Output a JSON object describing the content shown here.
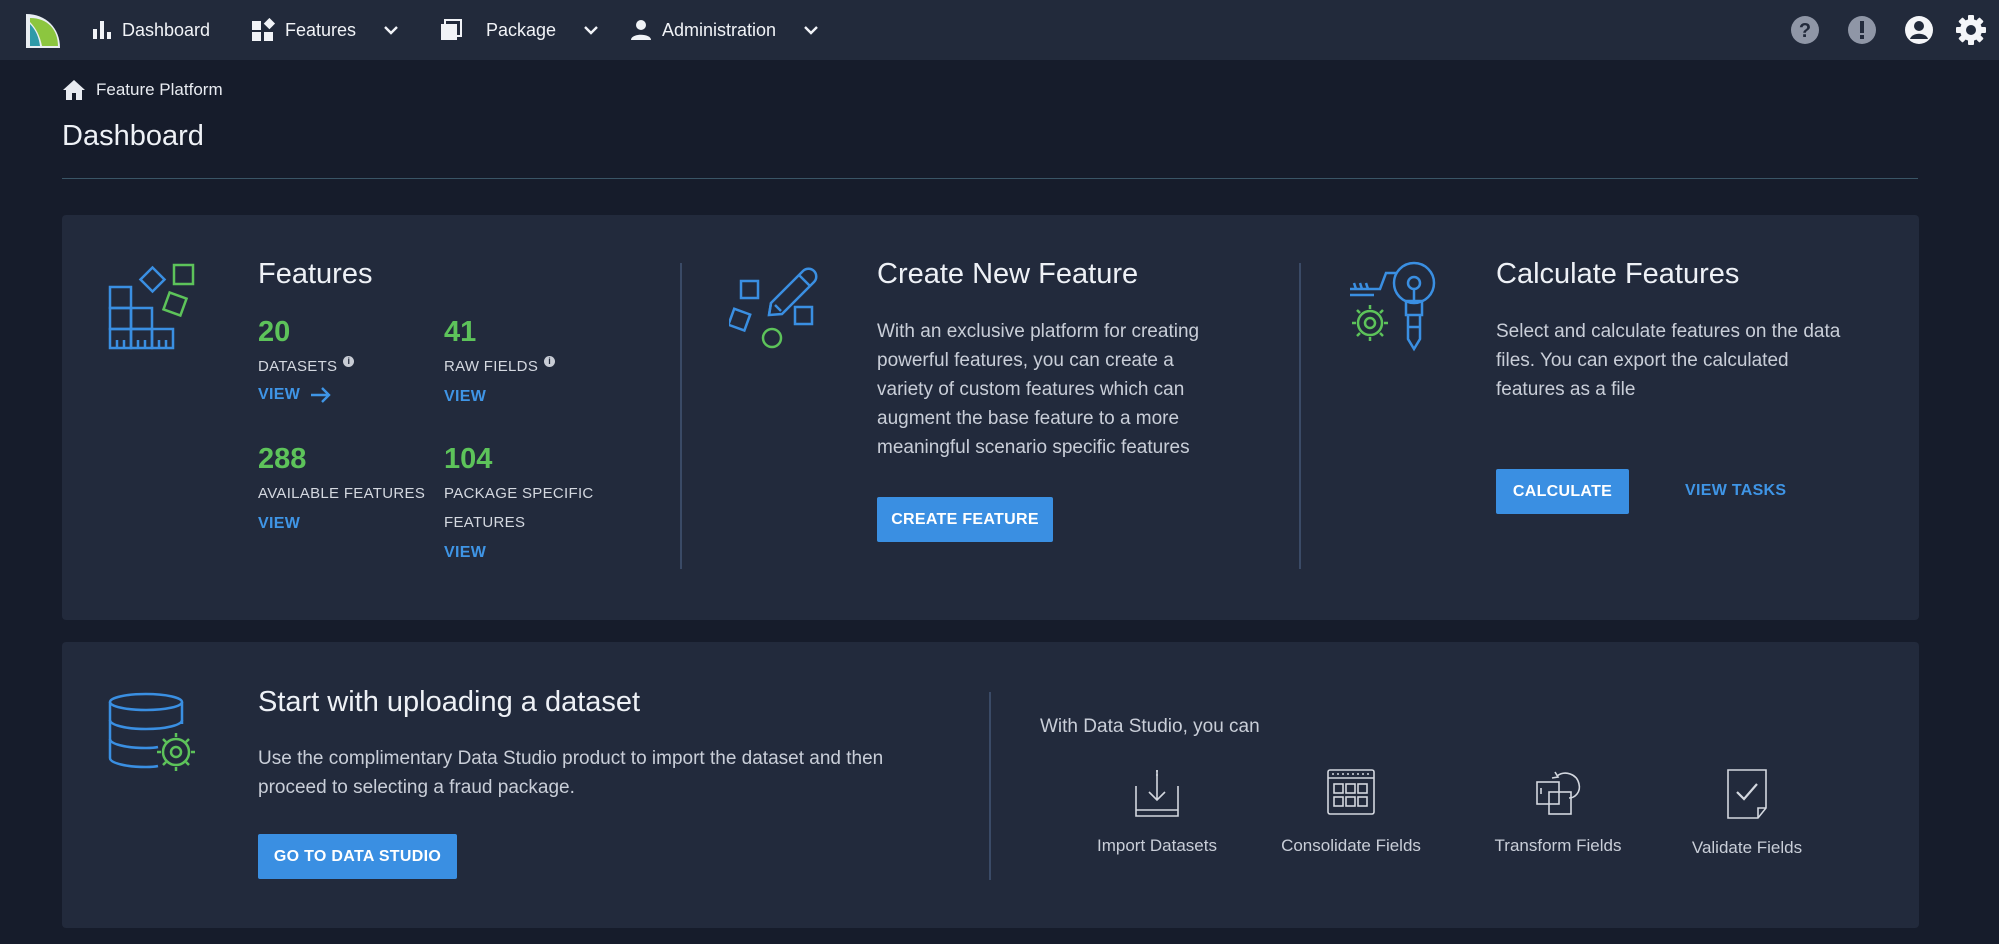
{
  "nav": {
    "items": [
      {
        "label": "Dashboard",
        "icon": "bar-chart-icon"
      },
      {
        "label": "Features",
        "icon": "widgets-icon"
      },
      {
        "label": "Package",
        "icon": "stack-icon"
      },
      {
        "label": "Administration",
        "icon": "person-icon"
      }
    ],
    "right_icons": [
      "help-icon",
      "alert-icon",
      "account-icon",
      "settings-icon"
    ]
  },
  "breadcrumb": {
    "label": "Feature Platform"
  },
  "page_title": "Dashboard",
  "features": {
    "title": "Features",
    "stats": [
      {
        "value": "20",
        "label": "DATASETS",
        "link": "VIEW"
      },
      {
        "value": "41",
        "label": "RAW FIELDS",
        "link": "VIEW"
      },
      {
        "value": "288",
        "label": "AVAILABLE FEATURES",
        "link": "VIEW"
      },
      {
        "value": "104",
        "label_line1": "PACKAGE SPECIFIC",
        "label_line2": "FEATURES",
        "link": "VIEW"
      }
    ]
  },
  "create": {
    "title": "Create New Feature",
    "lines": [
      "With an exclusive platform for creating",
      "powerful features, you can create a",
      "variety of custom features which can",
      "augment the base feature to a more",
      "meaningful scenario specific features"
    ],
    "button": "CREATE FEATURE"
  },
  "calculate": {
    "title": "Calculate Features",
    "lines": [
      "Select and calculate features on the data",
      "files. You can export the calculated",
      "features as a file"
    ],
    "button": "CALCULATE",
    "link": "VIEW TASKS"
  },
  "upload": {
    "title": "Start with uploading a dataset",
    "lines": [
      "Use the complimentary Data Studio product to import the dataset and then",
      "proceed to selecting a fraud package."
    ],
    "button": "GO TO DATA STUDIO"
  },
  "studio": {
    "intro": "With Data Studio, you can",
    "tools": [
      {
        "label": "Import Datasets",
        "icon": "import-icon"
      },
      {
        "label": "Consolidate Fields",
        "icon": "grid-icon"
      },
      {
        "label": "Transform Fields",
        "icon": "transform-icon"
      },
      {
        "label": "Validate Fields",
        "icon": "validate-icon"
      }
    ]
  },
  "colors": {
    "background": "#161c2b",
    "card": "#222a3c",
    "accent_blue": "#3a8fe2",
    "stat_green": "#5dc35a"
  }
}
